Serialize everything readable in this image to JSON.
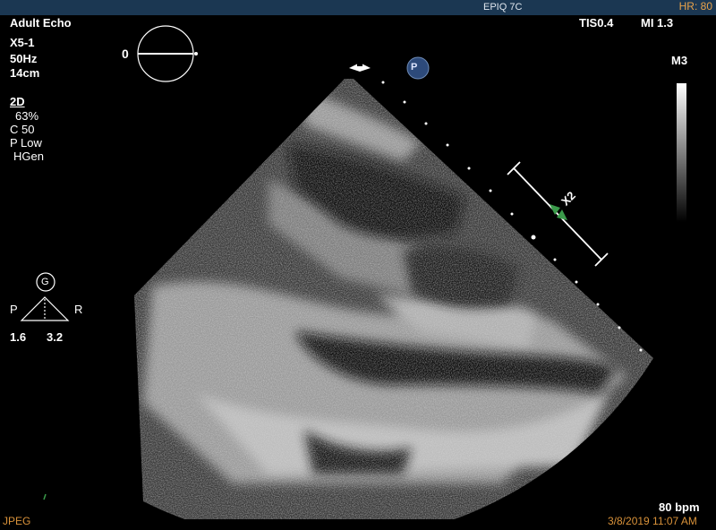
{
  "topbar": {
    "system": "EPIQ 7C",
    "heart_rate": "HR: 80"
  },
  "left_panel": {
    "preset": "Adult Echo",
    "transducer": "X5-1",
    "frame_rate": "50Hz",
    "depth": "14cm",
    "mode": "2D",
    "gain": "63%",
    "compression": "C 50",
    "power": "P Low",
    "frequency": "HGen"
  },
  "orientation": {
    "angle": "0"
  },
  "indices": {
    "tis": "TIS0.4",
    "mi": "MI 1.3"
  },
  "colormap_label": "M3",
  "marker_p": "P",
  "xplane": {
    "label": "X2"
  },
  "probe_icon": {
    "label": "G",
    "left": "P",
    "right": "R",
    "left_value": "1.6",
    "right_value": "3.2"
  },
  "bottom": {
    "bpm": "80 bpm",
    "format": "JPEG",
    "datetime": "3/8/2019 11:07 AM"
  },
  "colors": {
    "header_bg": "#1b3752",
    "accent_orange": "#d9923a",
    "marker_green": "#3a9a4a"
  }
}
